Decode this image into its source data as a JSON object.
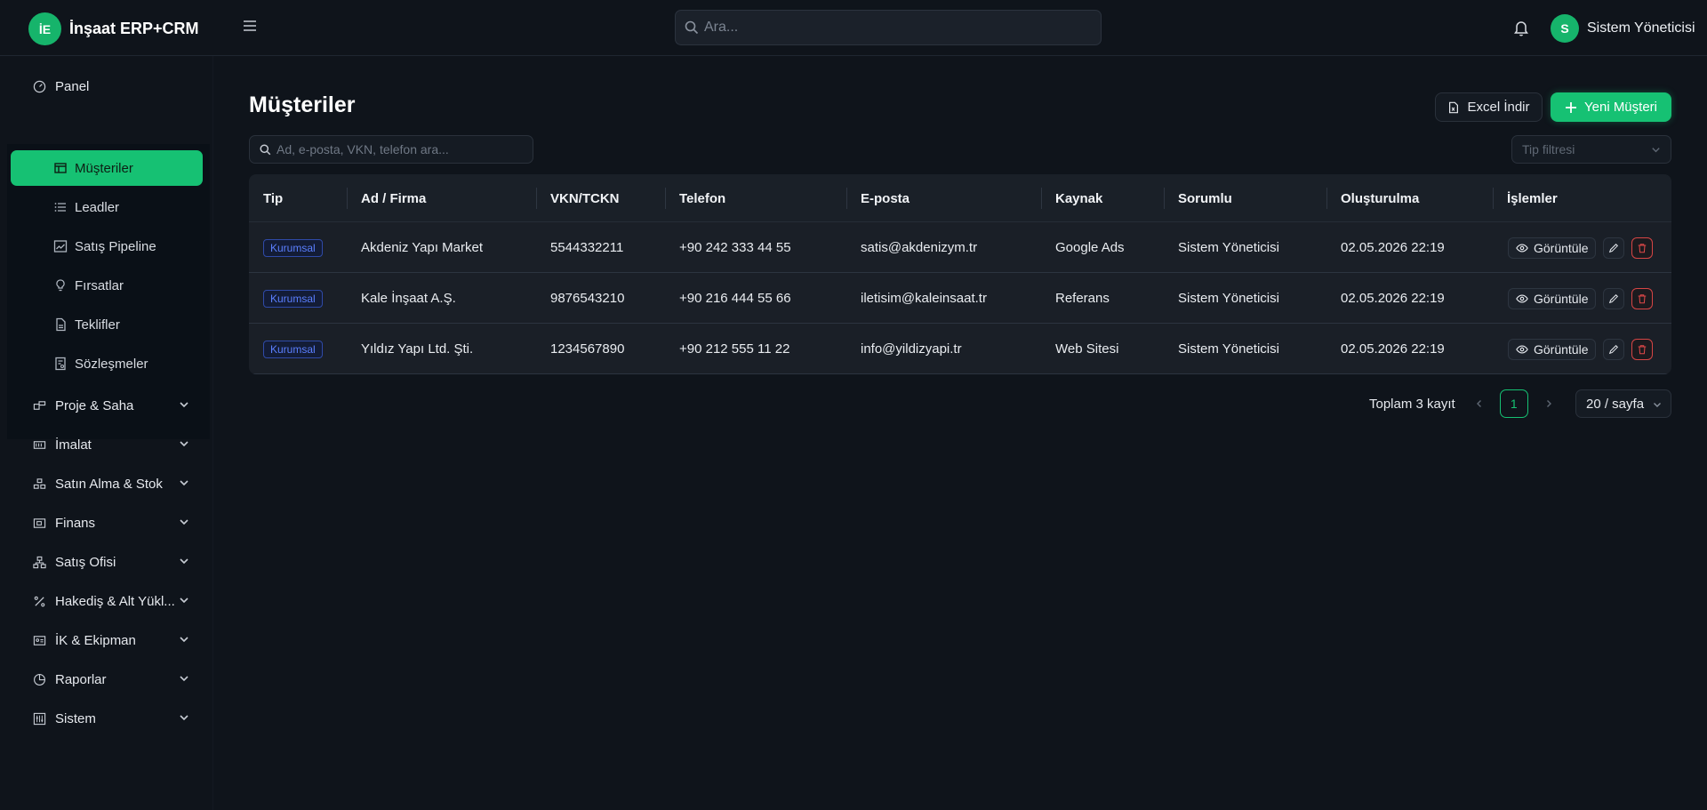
{
  "app": {
    "logo_text": "İE",
    "title": "İnşaat ERP+CRM"
  },
  "header": {
    "search_placeholder": "Ara...",
    "user_initial": "S",
    "user_name": "Sistem Yöneticisi"
  },
  "sidebar": {
    "panel": "Panel",
    "crm_items": [
      {
        "label": "Müşteriler",
        "icon": "store-icon",
        "active": true
      },
      {
        "label": "Leadler",
        "icon": "list-icon"
      },
      {
        "label": "Satış Pipeline",
        "icon": "chart-line-icon"
      },
      {
        "label": "Fırsatlar",
        "icon": "bulb-icon"
      },
      {
        "label": "Teklifler",
        "icon": "file-icon"
      },
      {
        "label": "Sözleşmeler",
        "icon": "contract-icon"
      }
    ],
    "groups": [
      {
        "label": "Proje & Saha",
        "icon": "project-icon"
      },
      {
        "label": "İmalat",
        "icon": "factory-icon"
      },
      {
        "label": "Satın Alma & Stok",
        "icon": "stock-icon"
      },
      {
        "label": "Finans",
        "icon": "wallet-icon"
      },
      {
        "label": "Satış Ofisi",
        "icon": "org-icon"
      },
      {
        "label": "Hakediş & Alt Yükl...",
        "icon": "percent-icon"
      },
      {
        "label": "İK & Ekipman",
        "icon": "id-card-icon"
      },
      {
        "label": "Raporlar",
        "icon": "pie-icon"
      },
      {
        "label": "Sistem",
        "icon": "settings-icon"
      }
    ]
  },
  "page": {
    "title": "Müşteriler",
    "excel_label": "Excel İndir",
    "new_label": "Yeni Müşteri",
    "search_placeholder": "Ad, e-posta, VKN, telefon ara...",
    "type_filter_placeholder": "Tip filtresi"
  },
  "table": {
    "columns": [
      "Tip",
      "Ad / Firma",
      "VKN/TCKN",
      "Telefon",
      "E-posta",
      "Kaynak",
      "Sorumlu",
      "Oluşturulma",
      "İşlemler"
    ],
    "view_label": "Görüntüle",
    "rows": [
      {
        "type": "Kurumsal",
        "name": "Akdeniz Yapı Market",
        "tax": "5544332211",
        "phone": "+90 242 333 44 55",
        "email": "satis@akdenizym.tr",
        "source": "Google Ads",
        "owner": "Sistem Yöneticisi",
        "created": "02.05.2026 22:19"
      },
      {
        "type": "Kurumsal",
        "name": "Kale İnşaat A.Ş.",
        "tax": "9876543210",
        "phone": "+90 216 444 55 66",
        "email": "iletisim@kaleinsaat.tr",
        "source": "Referans",
        "owner": "Sistem Yöneticisi",
        "created": "02.05.2026 22:19"
      },
      {
        "type": "Kurumsal",
        "name": "Yıldız Yapı Ltd. Şti.",
        "tax": "1234567890",
        "phone": "+90 212 555 11 22",
        "email": "info@yildizyapi.tr",
        "source": "Web Sitesi",
        "owner": "Sistem Yöneticisi",
        "created": "02.05.2026 22:19"
      }
    ]
  },
  "pagination": {
    "total": "Toplam 3 kayıt",
    "current_page": "1",
    "page_size": "20 / sayfa"
  },
  "colors": {
    "accent": "#16c173",
    "tag": "#5b7fff",
    "danger": "#d64545"
  }
}
